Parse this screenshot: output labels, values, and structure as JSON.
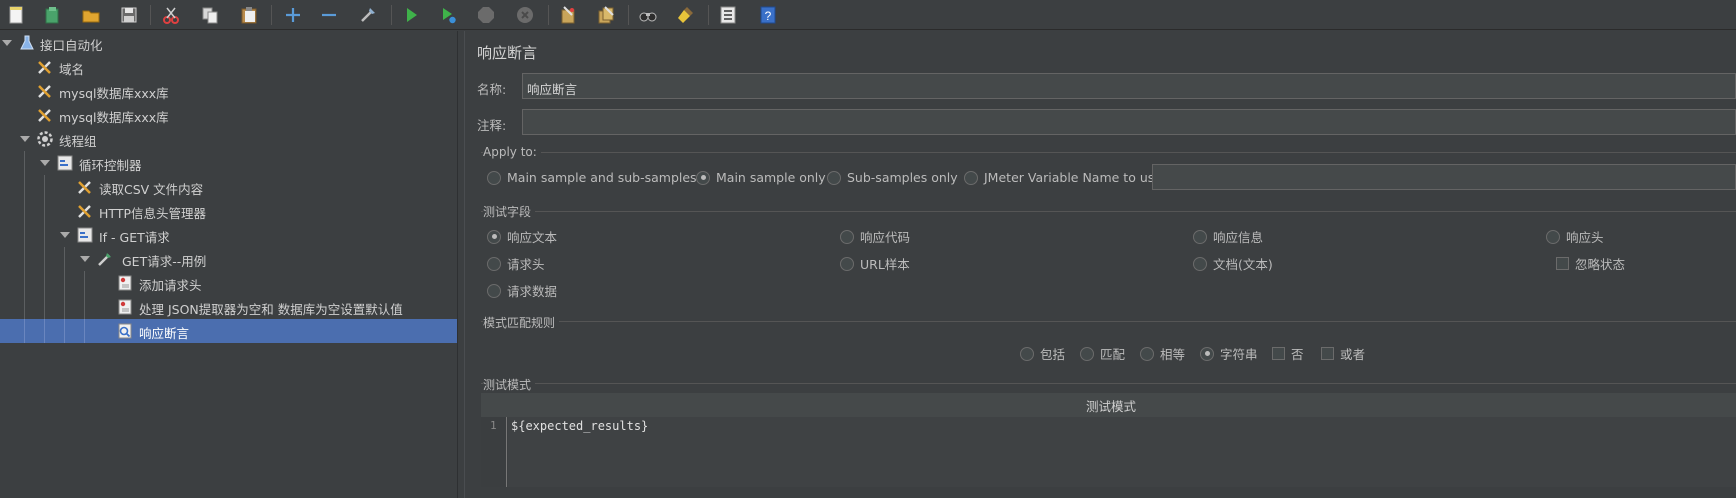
{
  "toolbar": {
    "buttons": [
      "new-icon",
      "templates-icon",
      "open-icon",
      "save-icon",
      "cut-icon",
      "copy-icon",
      "paste-icon",
      "expand-icon",
      "collapse-icon",
      "toggle-icon",
      "start-icon",
      "start-no-pause-icon",
      "stop-icon",
      "shutdown-icon",
      "clear-icon",
      "clear-all-icon",
      "search-icon",
      "reset-search-icon",
      "function-helper-icon",
      "help-icon"
    ]
  },
  "tree": {
    "nodes": [
      {
        "label": "接口自动化",
        "icon": "testplan-icon"
      },
      {
        "label": "域名",
        "icon": "config-element-icon"
      },
      {
        "label": "mysql数据库xxx库",
        "icon": "config-element-icon"
      },
      {
        "label": "mysql数据库xxx库",
        "icon": "config-element-icon"
      },
      {
        "label": "线程组",
        "icon": "thread-group-icon"
      },
      {
        "label": "循环控制器",
        "icon": "controller-icon"
      },
      {
        "label": "读取CSV 文件内容",
        "icon": "config-element-icon"
      },
      {
        "label": "HTTP信息头管理器",
        "icon": "config-element-icon"
      },
      {
        "label": "If - GET请求",
        "icon": "controller-icon"
      },
      {
        "label": "GET请求--用例",
        "icon": "sampler-icon"
      },
      {
        "label": "添加请求头",
        "icon": "preprocessor-icon"
      },
      {
        "label": "处理 JSON提取器为空和 数据库为空设置默认值",
        "icon": "preprocessor-icon"
      },
      {
        "label": "响应断言",
        "icon": "assertion-icon"
      }
    ]
  },
  "panel": {
    "title": "响应断言",
    "name_label": "名称:",
    "name_value": "响应断言",
    "comment_label": "注释:",
    "comment_value": "",
    "apply_to": {
      "title": "Apply to:",
      "options": [
        "Main sample and sub-samples",
        "Main sample only",
        "Sub-samples only",
        "JMeter Variable Name to use"
      ],
      "selected": "Main sample only",
      "variable_value": ""
    },
    "test_field": {
      "title": "测试字段",
      "options": [
        "响应文本",
        "响应代码",
        "响应信息",
        "响应头",
        "请求头",
        "URL样本",
        "文档(文本)",
        "请求数据"
      ],
      "selected": "响应文本",
      "ignore_status_label": "忽略状态",
      "ignore_status_checked": false
    },
    "pattern_rules": {
      "title": "模式匹配规则",
      "options": [
        "包括",
        "匹配",
        "相等",
        "字符串"
      ],
      "selected": "字符串",
      "not_label": "否",
      "or_label": "或者"
    },
    "patterns": {
      "title": "测试模式",
      "header": "测试模式",
      "line_number": "1",
      "value": "${expected_results}"
    }
  },
  "colors": {
    "background": "#3c3f41",
    "selection": "#4b6eaf",
    "field": "#45494a"
  }
}
